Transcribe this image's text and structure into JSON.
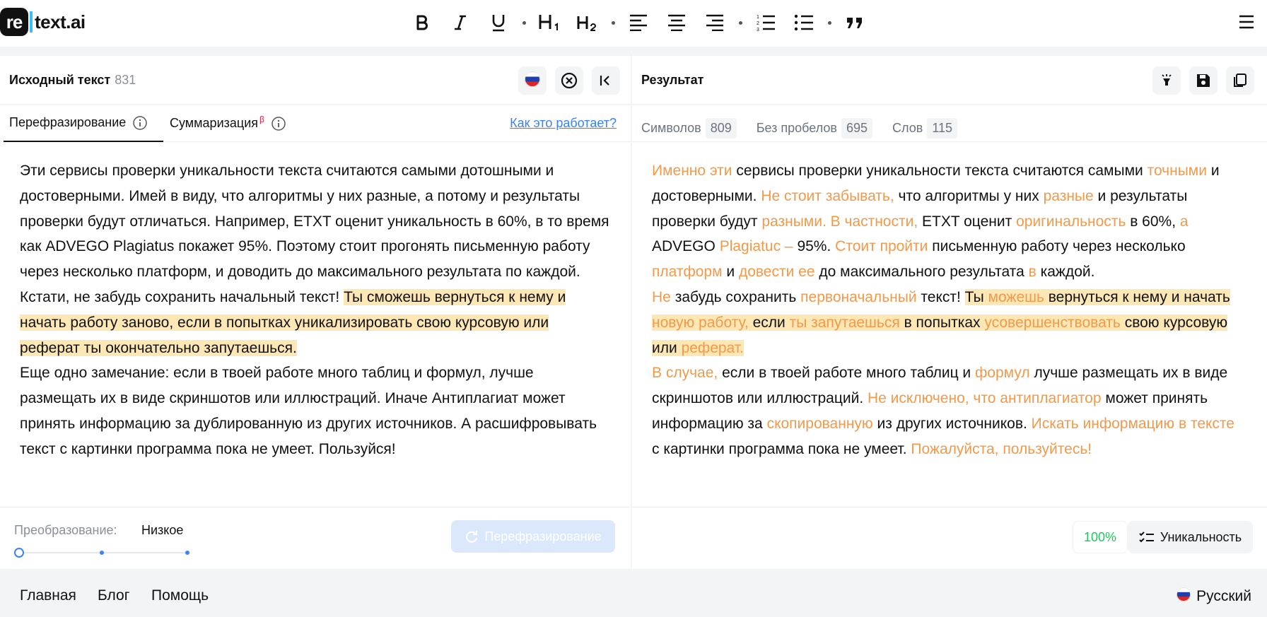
{
  "brand": {
    "logo_mark": "re",
    "logo_text": "text.ai"
  },
  "toolbar": {
    "items": [
      "bold-icon",
      "italic-icon",
      "underline-icon",
      "heading-1-icon",
      "heading-2-icon",
      "align-left-icon",
      "align-center-icon",
      "align-right-icon",
      "ordered-list-icon",
      "bullet-list-icon",
      "quote-icon"
    ]
  },
  "source": {
    "title": "Исходный текст",
    "char_count": "831",
    "tabs": [
      {
        "label": "Перефразирование",
        "active": true
      },
      {
        "label": "Суммаризация",
        "badge": "β"
      }
    ],
    "how_link": "Как это работает?",
    "paragraphs": [
      [
        {
          "t": "Эти сервисы проверки уникальности текста считаются самыми дотошными и достоверными. Имей в виду, что алгоритмы у них разные, а потому и результаты проверки будут отличаться. Например, ETXT оценит уникальность в 60%, в то время как ADVEGO Plagiatus покажет 95%. Поэтому стоит прогонять письменную работу через несколько платформ, и доводить до максимального результата по каждой."
        }
      ],
      [
        {
          "t": "Кстати, не забудь сохранить начальный текст! "
        },
        {
          "t": "Ты сможешь вернуться к нему и начать работу заново, если в попытках уникализировать свою курсовую или реферат ты окончательно запутаешься.",
          "h": true
        }
      ],
      [
        {
          "t": "Еще одно замечание: если в твоей работе много таблиц и формул, лучше размещать их в виде скриншотов или иллюстраций. Иначе Антиплагиат может принять информацию за дублированную из других источников. А расшифровывать текст с картинки программа пока не умеет. Пользуйся!"
        }
      ]
    ],
    "conversion_label": "Преобразование:",
    "conversion_value": "Низкое",
    "conversion_level": 0,
    "paraphrase_button": "Перефразирование"
  },
  "result": {
    "title": "Результат",
    "stats": [
      {
        "label": "Символов",
        "value": "809"
      },
      {
        "label": "Без пробелов",
        "value": "695"
      },
      {
        "label": "Слов",
        "value": "115"
      }
    ],
    "paragraphs": [
      [
        {
          "t": "Именно эти",
          "c": true
        },
        {
          "t": " сервисы проверки уникальности текста считаются самыми "
        },
        {
          "t": "точными",
          "c": true
        },
        {
          "t": " и достоверными. "
        },
        {
          "t": "Не стоит забывать,",
          "c": true
        },
        {
          "t": " что алгоритмы у них "
        },
        {
          "t": "разные",
          "c": true
        },
        {
          "t": " и результаты проверки будут "
        },
        {
          "t": "разными. В частности,",
          "c": true
        },
        {
          "t": " ETXT оценит "
        },
        {
          "t": "оригинальность",
          "c": true
        },
        {
          "t": " в 60%, "
        },
        {
          "t": "а",
          "c": true
        },
        {
          "t": " ADVEGO "
        },
        {
          "t": "Plagiatuc –",
          "c": true
        },
        {
          "t": " 95%. "
        },
        {
          "t": "Стоит пройти",
          "c": true
        },
        {
          "t": " письменную работу через несколько "
        },
        {
          "t": "платформ",
          "c": true
        },
        {
          "t": " и "
        },
        {
          "t": "довести ее",
          "c": true
        },
        {
          "t": " до максимального результата "
        },
        {
          "t": "в",
          "c": true
        },
        {
          "t": " каждой."
        }
      ],
      [
        {
          "t": "Не",
          "c": true
        },
        {
          "t": " забудь сохранить "
        },
        {
          "t": "первоначальный",
          "c": true
        },
        {
          "t": " текст! "
        },
        {
          "t": "Ты ",
          "h": true
        },
        {
          "t": "можешь",
          "c": true,
          "h": true
        },
        {
          "t": " вернуться к нему и начать ",
          "h": true
        },
        {
          "t": "новую работу,",
          "c": true,
          "h": true
        },
        {
          "t": " если ",
          "h": true
        },
        {
          "t": "ты запутаешься",
          "c": true,
          "h": true
        },
        {
          "t": " в попытках ",
          "h": true
        },
        {
          "t": "усовершенствовать",
          "c": true,
          "h": true
        },
        {
          "t": " свою курсовую или ",
          "h": true
        },
        {
          "t": "реферат.",
          "c": true,
          "h": true
        }
      ],
      [
        {
          "t": "В случае,",
          "c": true
        },
        {
          "t": " если в твоей работе много таблиц и "
        },
        {
          "t": "формул",
          "c": true
        },
        {
          "t": " лучше размещать их в виде скриншотов или иллюстраций. "
        },
        {
          "t": "Не исключено, что антиплагиатор",
          "c": true
        },
        {
          "t": " может принять информацию за "
        },
        {
          "t": "скопированную",
          "c": true
        },
        {
          "t": " из других источников. "
        },
        {
          "t": "Искать информацию в тексте",
          "c": true
        },
        {
          "t": " с картинки программа пока не умеет. "
        },
        {
          "t": "Пожалуйста, пользуйтесь!",
          "c": true
        }
      ]
    ],
    "uniqueness_percent": "100%",
    "uniqueness_button": "Уникальность"
  },
  "footer": {
    "links": [
      "Главная",
      "Блог",
      "Помощь"
    ],
    "language": "Русский"
  },
  "colors": {
    "accent": "#3b82f6",
    "changed_text": "#f2994a",
    "highlight": "#fde7b5",
    "success": "#22c55e"
  }
}
